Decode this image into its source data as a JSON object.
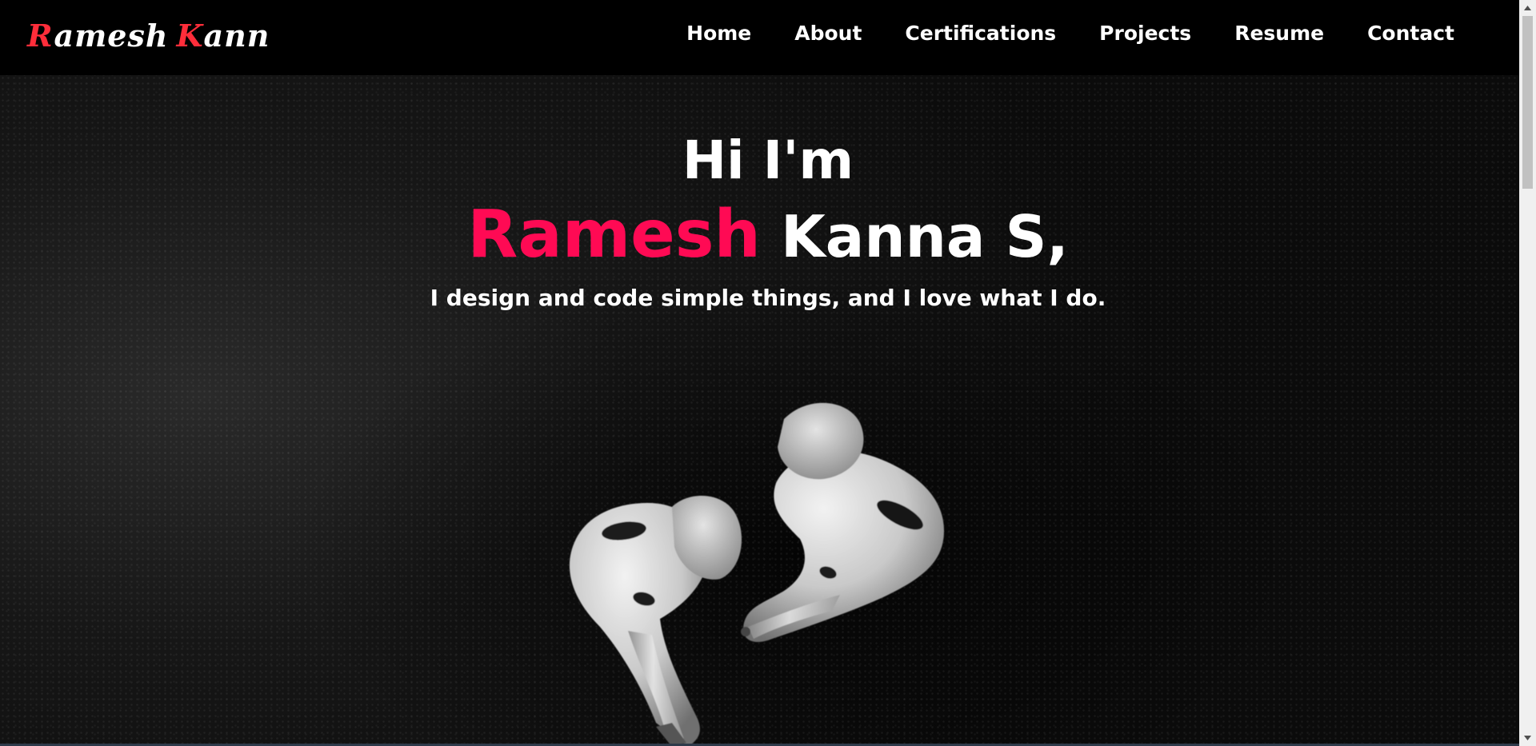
{
  "logo": {
    "first_initial": "R",
    "first_rest": "amesh",
    "last_initial": "K",
    "last_rest": "ann"
  },
  "nav": {
    "items": [
      {
        "label": "Home"
      },
      {
        "label": "About"
      },
      {
        "label": "Certifications"
      },
      {
        "label": "Projects"
      },
      {
        "label": "Resume"
      },
      {
        "label": "Contact"
      }
    ]
  },
  "hero": {
    "greeting": "Hi I'm",
    "first_name": "Ramesh",
    "last_name": "Kanna S,",
    "tagline": "I design and code simple things, and I love what I do."
  },
  "colors": {
    "logo_accent": "#ff2d3a",
    "name_accent": "#ff0a54",
    "nav_bg": "#000000",
    "text": "#ffffff"
  },
  "icons": {
    "hero_image": "earbuds-image",
    "scroll_up": "triangle-up-icon",
    "scroll_down": "triangle-down-icon"
  }
}
